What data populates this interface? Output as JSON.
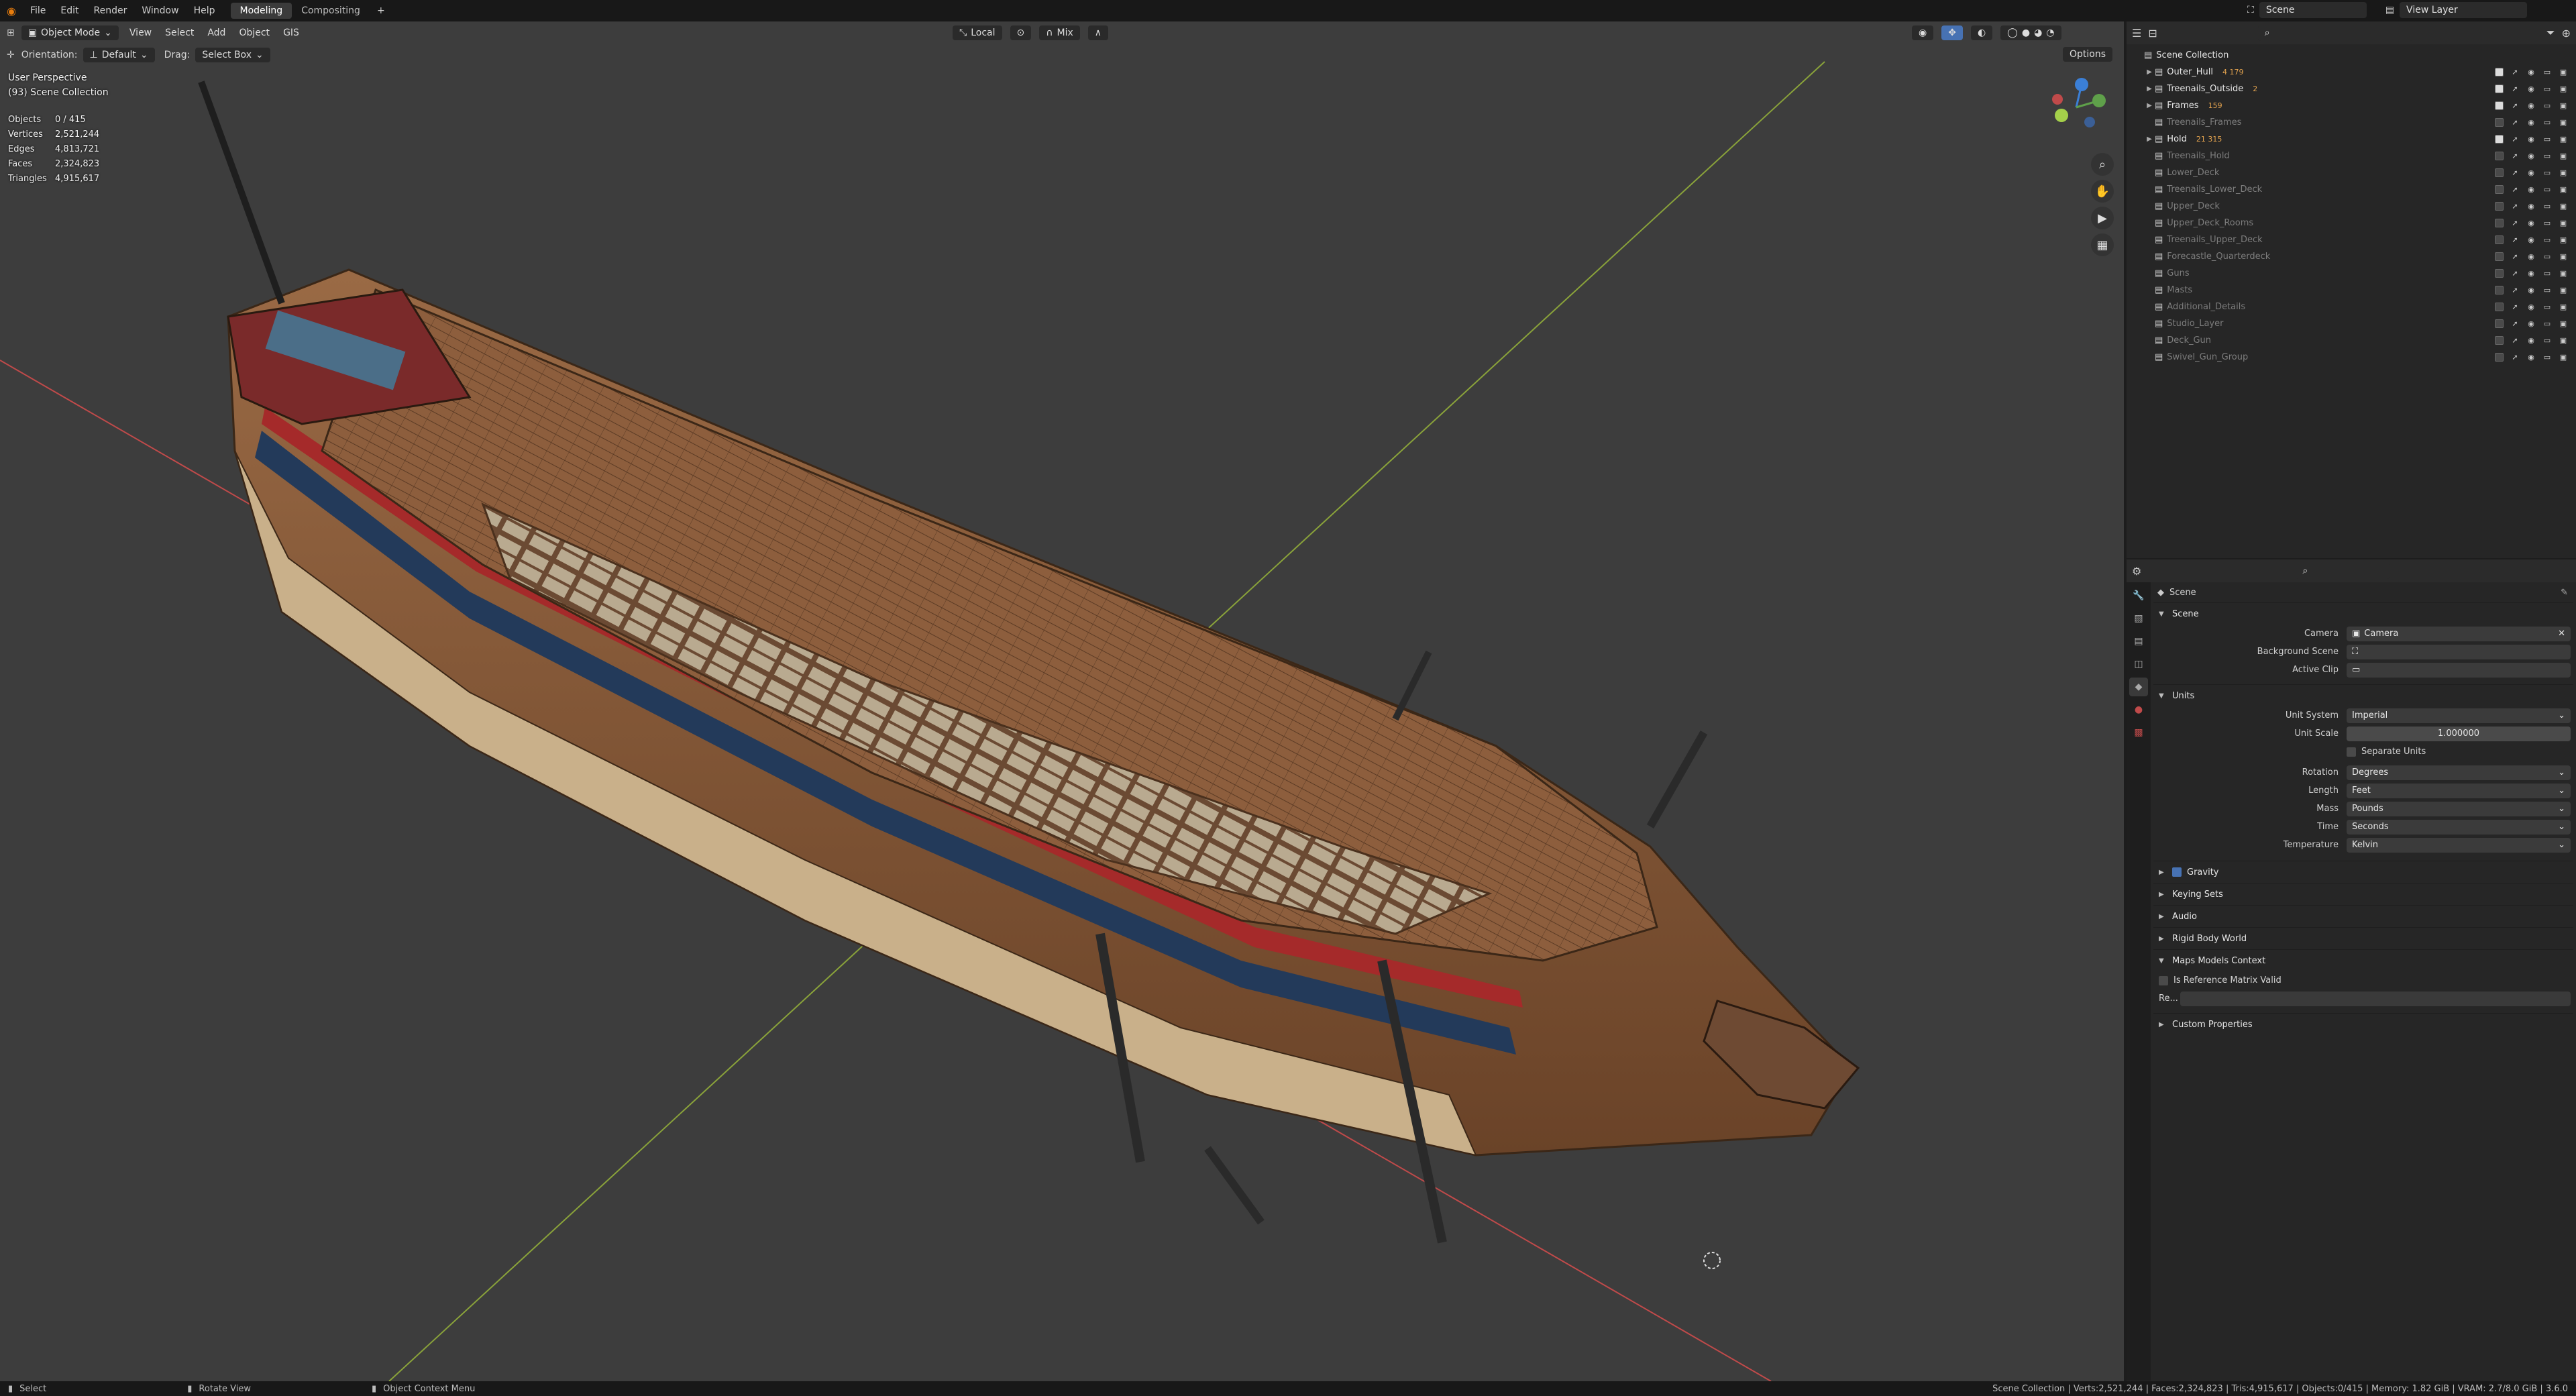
{
  "topbar": {
    "menus": [
      "File",
      "Edit",
      "Render",
      "Window",
      "Help"
    ],
    "workspaces": [
      {
        "label": "Modeling",
        "active": true
      },
      {
        "label": "Compositing",
        "active": false
      }
    ],
    "add_tab": "+",
    "scene": "Scene",
    "view_layer": "View Layer"
  },
  "viewport": {
    "mode": "Object Mode",
    "menus": [
      "View",
      "Select",
      "Add",
      "Object",
      "GIS"
    ],
    "orientation_label": "Orientation:",
    "orientation_value": "Default",
    "drag_label": "Drag:",
    "drag_value": "Select Box",
    "transform_space": "Local",
    "snap_mode": "Mix",
    "options": "Options",
    "perspective": "User Perspective",
    "collection": "(93) Scene Collection",
    "stats": [
      {
        "k": "Objects",
        "v": "0 / 415"
      },
      {
        "k": "Vertices",
        "v": "2,521,244"
      },
      {
        "k": "Edges",
        "v": "4,813,721"
      },
      {
        "k": "Faces",
        "v": "2,324,823"
      },
      {
        "k": "Triangles",
        "v": "4,915,617"
      }
    ]
  },
  "outliner": {
    "root": "Scene Collection",
    "items": [
      {
        "label": "Outer_Hull",
        "dim": false,
        "expand": true,
        "checked": true,
        "badge": "4 179"
      },
      {
        "label": "Treenails_Outside",
        "dim": false,
        "expand": true,
        "checked": true,
        "badge": "2"
      },
      {
        "label": "Frames",
        "dim": false,
        "expand": true,
        "checked": true,
        "badge": "159"
      },
      {
        "label": "Treenails_Frames",
        "dim": true,
        "expand": false,
        "checked": false,
        "badge": ""
      },
      {
        "label": "Hold",
        "dim": false,
        "expand": true,
        "checked": true,
        "badge": "21 315"
      },
      {
        "label": "Treenails_Hold",
        "dim": true,
        "expand": false,
        "checked": false,
        "badge": ""
      },
      {
        "label": "Lower_Deck",
        "dim": true,
        "expand": false,
        "checked": false,
        "badge": ""
      },
      {
        "label": "Treenails_Lower_Deck",
        "dim": true,
        "expand": false,
        "checked": false,
        "badge": ""
      },
      {
        "label": "Upper_Deck",
        "dim": true,
        "expand": false,
        "checked": false,
        "badge": ""
      },
      {
        "label": "Upper_Deck_Rooms",
        "dim": true,
        "expand": false,
        "checked": false,
        "badge": ""
      },
      {
        "label": "Treenails_Upper_Deck",
        "dim": true,
        "expand": false,
        "checked": false,
        "badge": ""
      },
      {
        "label": "Forecastle_Quarterdeck",
        "dim": true,
        "expand": false,
        "checked": false,
        "badge": ""
      },
      {
        "label": "Guns",
        "dim": true,
        "expand": false,
        "checked": false,
        "badge": ""
      },
      {
        "label": "Masts",
        "dim": true,
        "expand": false,
        "checked": false,
        "badge": ""
      },
      {
        "label": "Additional_Details",
        "dim": true,
        "expand": false,
        "checked": false,
        "badge": ""
      },
      {
        "label": "Studio_Layer",
        "dim": true,
        "expand": false,
        "checked": false,
        "badge": ""
      },
      {
        "label": "Deck_Gun",
        "dim": true,
        "expand": false,
        "checked": false,
        "badge": ""
      },
      {
        "label": "Swivel_Gun_Group",
        "dim": true,
        "expand": false,
        "checked": false,
        "badge": ""
      }
    ]
  },
  "properties": {
    "context": "Scene",
    "scene_section": "Scene",
    "camera_label": "Camera",
    "camera_value": "Camera",
    "bg_scene_label": "Background Scene",
    "active_clip_label": "Active Clip",
    "units_section": "Units",
    "unit_system_label": "Unit System",
    "unit_system_value": "Imperial",
    "unit_scale_label": "Unit Scale",
    "unit_scale_value": "1.000000",
    "separate_units": "Separate Units",
    "rotation_label": "Rotation",
    "rotation_value": "Degrees",
    "length_label": "Length",
    "length_value": "Feet",
    "mass_label": "Mass",
    "mass_value": "Pounds",
    "time_label": "Time",
    "time_value": "Seconds",
    "temperature_label": "Temperature",
    "temperature_value": "Kelvin",
    "gravity": "Gravity",
    "keying_sets": "Keying Sets",
    "audio": "Audio",
    "rigid_body_world": "Rigid Body World",
    "maps_models_context": "Maps Models Context",
    "ref_matrix_valid": "Is Reference Matrix Valid",
    "re_label": "Re...",
    "custom_properties": "Custom Properties"
  },
  "status": {
    "select": "Select",
    "rotate": "Rotate View",
    "context_menu": "Object Context Menu",
    "info": "Scene Collection | Verts:2,521,244 | Faces:2,324,823 | Tris:4,915,617 | Objects:0/415 | Memory: 1.82 GiB | VRAM: 2.7/8.0 GiB | 3.6.0"
  },
  "colors": {
    "viewport_bg": "#3d3d3d",
    "hull_wood": "#8a5a3a",
    "hull_red": "#a52a2a",
    "hull_blue": "#233a5a",
    "axis_x": "#c04a4a",
    "axis_y": "#8aa33a"
  },
  "icons": [
    "blender-icon",
    "search-icon",
    "filter-icon",
    "eye-icon",
    "camera-icon",
    "hand-icon",
    "zoom-icon",
    "grid-icon"
  ]
}
